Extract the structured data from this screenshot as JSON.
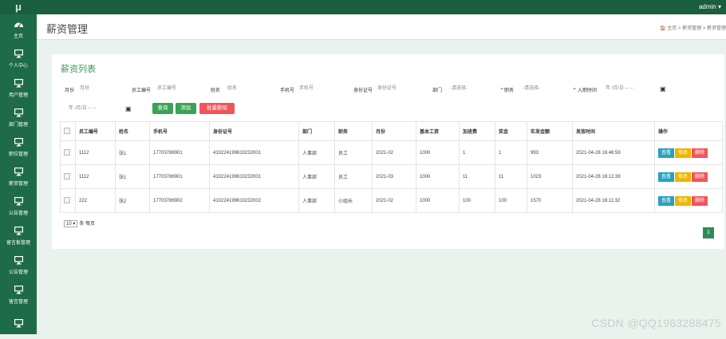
{
  "logo": "μ",
  "user": "admin ▾",
  "sidebar": [
    {
      "label": "主页",
      "icon": "dashboard-icon"
    },
    {
      "label": "个人中心",
      "icon": "monitor-icon"
    },
    {
      "label": "用户管理",
      "icon": "monitor-icon"
    },
    {
      "label": "部门管理",
      "icon": "monitor-icon"
    },
    {
      "label": "职位管理",
      "icon": "monitor-icon"
    },
    {
      "label": "薪资管理",
      "icon": "monitor-icon"
    },
    {
      "label": "公告管理",
      "icon": "monitor-icon"
    },
    {
      "label": "留言板管理",
      "icon": "monitor-icon"
    },
    {
      "label": "公告管理",
      "icon": "monitor-icon"
    },
    {
      "label": "留言管理",
      "icon": "monitor-icon"
    },
    {
      "label": "",
      "icon": "monitor-icon"
    }
  ],
  "header": {
    "title": "薪资管理",
    "crumbs": "🏠 主页  >  薪资管理  >  薪资管理"
  },
  "panel": {
    "title": "薪资列表"
  },
  "filters": {
    "month_label": "月份",
    "month_ph": "月份",
    "empno_label": "员工编号",
    "empno_ph": "员工编号",
    "name_label": "姓名",
    "name_ph": "姓名",
    "phone_label": "手机号",
    "phone_ph": "手机号",
    "idcard_label": "身份证号",
    "idcard_ph": "身份证号",
    "dept_label": "部门",
    "dept_value": "-请选择-",
    "pos_label": "职务",
    "pos_value": "-请选择-",
    "join_label": "入职时间",
    "date_ph": "年 /月/日 -- --",
    "date2_ph": "年 /月/日 -- --",
    "calendar": "▣"
  },
  "buttons": {
    "query": "查询",
    "add": "添加",
    "batch_delete": "批量删除"
  },
  "table": {
    "headers": [
      "员工编号",
      "姓名",
      "手机号",
      "身份证号",
      "部门",
      "职务",
      "月份",
      "基本工资",
      "加班费",
      "奖金",
      "实发金额",
      "发放时间",
      "操作"
    ],
    "rows": [
      [
        "1112",
        "张1",
        "17703786901",
        "410224199610232001",
        "人事部",
        "员工",
        "2021-02",
        "1000",
        "1",
        "1",
        "993",
        "2021-04-28 16:46:59"
      ],
      [
        "1112",
        "张1",
        "17703786901",
        "410224199610232001",
        "人事部",
        "员工",
        "2021-03",
        "1000",
        "11",
        "11",
        "1023",
        "2021-04-28 16:12:39"
      ],
      [
        "222",
        "张2",
        "17703786902",
        "410224199610232002",
        "人事部",
        "小组长",
        "2021-02",
        "1000",
        "100",
        "100",
        "1570",
        "2021-04-28 16:11:32"
      ]
    ],
    "ops": {
      "view": "查看",
      "edit": "修改",
      "del": "删除"
    }
  },
  "pager": {
    "size": "10 ▾",
    "per_page": "条 每页",
    "page": "1"
  },
  "watermark": "CSDN @QQ1963288475"
}
